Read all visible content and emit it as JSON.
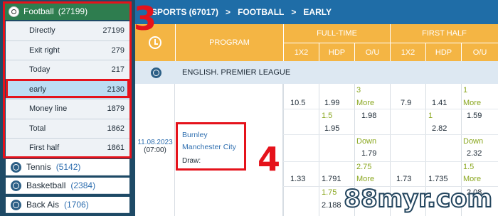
{
  "sidebar": {
    "football": {
      "name": "Football",
      "count": "(27199)"
    },
    "sub_items": [
      {
        "label": "Directly",
        "count": "27199"
      },
      {
        "label": "Exit right",
        "count": "279"
      },
      {
        "label": "Today",
        "count": "217"
      },
      {
        "label": "early",
        "count": "2130"
      },
      {
        "label": "Money line",
        "count": "1879"
      },
      {
        "label": "Total",
        "count": "1862"
      },
      {
        "label": "First half",
        "count": "1861"
      }
    ],
    "sports": [
      {
        "name": "Tennis",
        "count": "(5142)"
      },
      {
        "name": "Basketball",
        "count": "(2384)"
      },
      {
        "name": "Back Ais",
        "count": "(1706)"
      }
    ]
  },
  "breadcrumb": {
    "part1": "SPORTS (67017)",
    "sep1": ">",
    "part2": "FOOTBALL",
    "sep2": ">",
    "part3": "EARLY"
  },
  "table": {
    "program_label": "PROGRAM",
    "full_time_label": "FULL-TIME",
    "first_half_label": "FIRST HALF",
    "cols": [
      "1X2",
      "HDP",
      "O/U",
      "1X2",
      "HDP",
      "O/U"
    ],
    "league": "ENGLISH. PREMIER LEAGUE",
    "date": "11.08.2023",
    "time": "(07:00)",
    "home": "Burnley",
    "away": "Manchester City",
    "draw": "Draw:",
    "odds": {
      "ft_1x2": [
        "10.5",
        "1.33"
      ],
      "ft_hdp": [
        "1.99",
        "1.5",
        "1.95",
        "1.791",
        "1.75",
        "2.188"
      ],
      "ft_ou": [
        "3",
        "More",
        "1.98",
        "Down",
        "1.79",
        "2.75",
        "More",
        "1.98"
      ],
      "fh_1x2": [
        "7.9",
        "1.73"
      ],
      "fh_hdp": [
        "1.41",
        "1",
        "2.82",
        "1.735"
      ],
      "fh_ou": [
        "1",
        "More",
        "1.59",
        "Down",
        "2.32",
        "1.5",
        "More",
        "2.08"
      ]
    }
  },
  "annotations": {
    "label3": "3",
    "label4": "4"
  },
  "watermark": "88myr.com"
}
